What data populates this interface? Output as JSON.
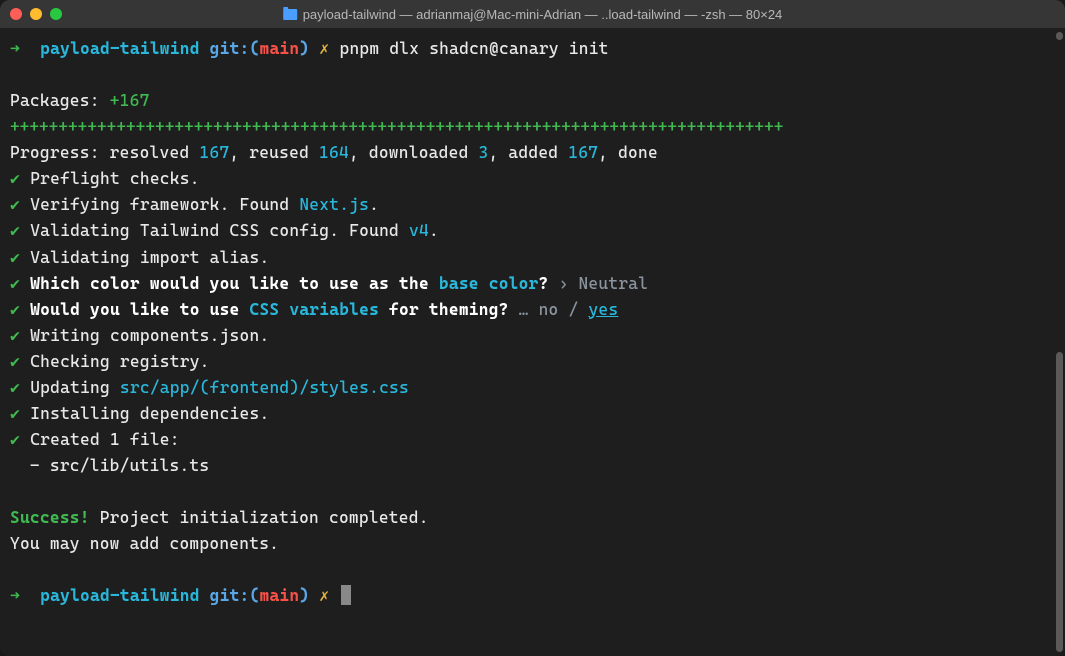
{
  "window": {
    "title": "payload-tailwind — adrianmaj@Mac-mini-Adrian — ..load-tailwind — -zsh — 80×24"
  },
  "prompt1": {
    "arrow": "➜",
    "dir": "payload-tailwind",
    "git": "git:(",
    "branch": "main",
    "gitclose": ")",
    "dirty": "✗",
    "command": "pnpm dlx shadcn@canary init"
  },
  "packages": {
    "label": "Packages:",
    "count": "+167"
  },
  "pluses": "++++++++++++++++++++++++++++++++++++++++++++++++++++++++++++++++++++++++++++++++",
  "progress": {
    "prefix": "Progress: resolved ",
    "n1": "167",
    "t1": ", reused ",
    "n2": "164",
    "t2": ", downloaded ",
    "n3": "3",
    "t3": ", added ",
    "n4": "167",
    "t4": ", done"
  },
  "steps": {
    "s1": "Preflight checks.",
    "s2a": "Verifying framework. Found ",
    "s2b": "Next.js",
    "s2c": ".",
    "s3a": "Validating Tailwind CSS config. Found ",
    "s3b": "v4",
    "s3c": ".",
    "s4": "Validating import alias.",
    "q1a": "Which color would you like to use as the ",
    "q1b": "base color",
    "q1c": "?",
    "q1arrow": " › ",
    "q1ans": "Neutral",
    "q2a": "Would you like to use ",
    "q2b": "CSS variables",
    "q2c": " for theming?",
    "q2dots": " … ",
    "q2no": "no",
    "q2slash": " / ",
    "q2yes": "yes",
    "s5": "Writing components.json.",
    "s6": "Checking registry.",
    "s7a": "Updating ",
    "s7b": "src/app/(frontend)/styles.css",
    "s8": "Installing dependencies.",
    "s9": "Created 1 file:",
    "s9file": "  - src/lib/utils.ts"
  },
  "footer": {
    "success": "Success!",
    "msg1": " Project initialization completed.",
    "msg2": "You may now add components."
  },
  "prompt2": {
    "arrow": "➜",
    "dir": "payload-tailwind",
    "git": "git:(",
    "branch": "main",
    "gitclose": ")",
    "dirty": "✗"
  }
}
